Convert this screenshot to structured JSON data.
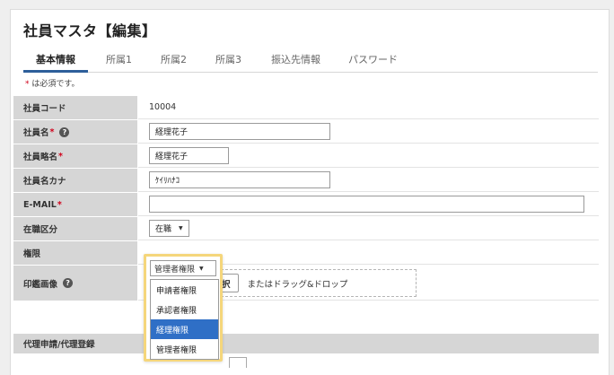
{
  "page": {
    "title": "社員マスタ【編集】"
  },
  "tabs": [
    {
      "label": "基本情報"
    },
    {
      "label": "所属1"
    },
    {
      "label": "所属2"
    },
    {
      "label": "所属3"
    },
    {
      "label": "振込先情報"
    },
    {
      "label": "パスワード"
    }
  ],
  "note": {
    "star": "*",
    "text": " は必須です。"
  },
  "fields": {
    "employee_code": {
      "label": "社員コード",
      "value": "10004"
    },
    "employee_name": {
      "label": "社員名",
      "value": "経理花子"
    },
    "employee_short": {
      "label": "社員略名",
      "value": "経理花子"
    },
    "employee_kana": {
      "label": "社員名カナ",
      "value": "ｹｲﾘﾊﾅｺ"
    },
    "email": {
      "label": "E-MAIL",
      "value": ""
    },
    "status": {
      "label": "在職区分",
      "value": "在職"
    },
    "role": {
      "label": "権限",
      "value": "管理者権限"
    },
    "seal": {
      "label": "印鑑画像",
      "file_button": "ファイルを選択",
      "drop_text": "またはドラッグ&ドロップ"
    }
  },
  "required_mark": "*",
  "help_mark": "?",
  "section": {
    "label": "代理申請/代理登録"
  },
  "role_dropdown": {
    "options": [
      "申請者権限",
      "承認者権限",
      "経理権限",
      "管理者権限"
    ],
    "highlighted_index": 2
  },
  "colors": {
    "accent": "#2e5f9a",
    "highlight": "#f5d67b",
    "selected": "#2f6fc6",
    "required": "#d0021b"
  }
}
